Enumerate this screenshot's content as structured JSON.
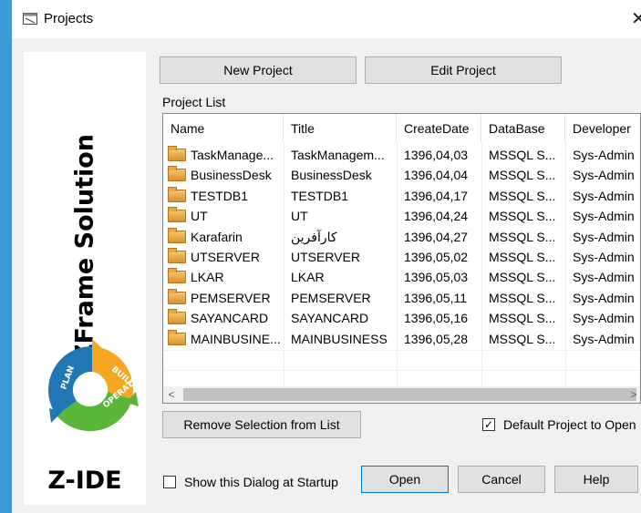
{
  "window": {
    "title": "Projects",
    "close_glyph": "✕"
  },
  "branding": {
    "vertical_text": "ZFrame Solution",
    "logo_label": "Z-IDE",
    "cycle_labels": {
      "plan": "PLAN",
      "build": "BUILD",
      "operate": "OPERATE"
    }
  },
  "toolbar": {
    "new_project": "New Project",
    "edit_project": "Edit Project"
  },
  "project_list": {
    "label": "Project List",
    "columns": [
      "Name",
      "Title",
      "CreateDate",
      "DataBase",
      "Developer"
    ],
    "rows": [
      [
        "TaskManage...",
        "TaskManagem...",
        "1396,04,03",
        "MSSQL S...",
        "Sys-Admin"
      ],
      [
        "BusinessDesk",
        "BusinessDesk",
        "1396,04,04",
        "MSSQL S...",
        "Sys-Admin"
      ],
      [
        "TESTDB1",
        "TESTDB1",
        "1396,04,17",
        "MSSQL S...",
        "Sys-Admin"
      ],
      [
        "UT",
        "UT",
        "1396,04,24",
        "MSSQL S...",
        "Sys-Admin"
      ],
      [
        "Karafarin",
        "کارآفرین",
        "1396,04,27",
        "MSSQL S...",
        "Sys-Admin"
      ],
      [
        "UTSERVER",
        "UTSERVER",
        "1396,05,02",
        "MSSQL S...",
        "Sys-Admin"
      ],
      [
        "LKAR",
        "LKAR",
        "1396,05,03",
        "MSSQL S...",
        "Sys-Admin"
      ],
      [
        "PEMSERVER",
        "PEMSERVER",
        "1396,05,11",
        "MSSQL S...",
        "Sys-Admin"
      ],
      [
        "SAYANCARD",
        "SAYANCARD",
        "1396,05,16",
        "MSSQL S...",
        "Sys-Admin"
      ],
      [
        "MAINBUSINE...",
        "MAINBUSINESS",
        "1396,05,28",
        "MSSQL S...",
        "Sys-Admin"
      ]
    ],
    "scroll_left": "<",
    "scroll_right": ">"
  },
  "actions": {
    "remove_selection": "Remove Selection from List",
    "default_project": {
      "label": "Default Project to Open",
      "checked": true,
      "glyph": "✓"
    },
    "show_at_startup": {
      "label": "Show this Dialog at Startup",
      "checked": false
    }
  },
  "footer": {
    "open": "Open",
    "cancel": "Cancel",
    "help": "Help"
  },
  "colors": {
    "desktop": "#3d9ad8",
    "dialog": "#f0f0f0",
    "plan": "#1f78b4",
    "build": "#f5a623",
    "operate": "#5ab539"
  }
}
